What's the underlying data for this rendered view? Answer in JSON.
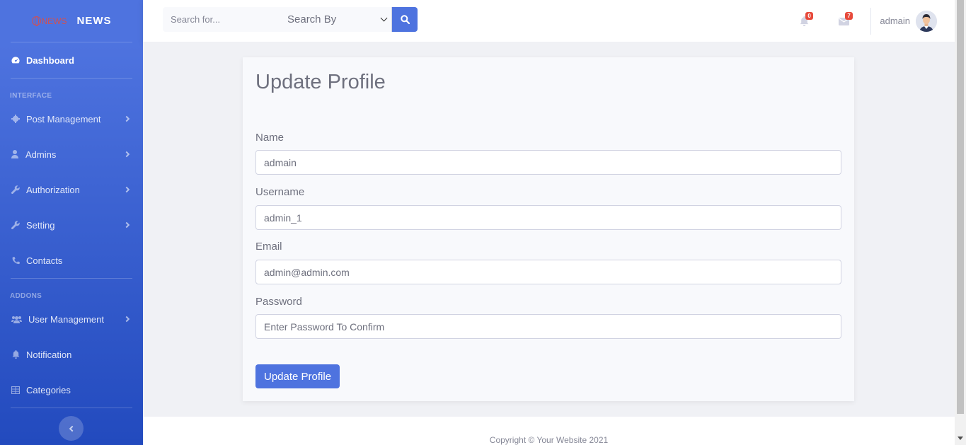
{
  "brand": {
    "logo_text": "NEWS",
    "title": "NEWS"
  },
  "sidebar": {
    "dashboard": "Dashboard",
    "heading_interface": "INTERFACE",
    "heading_addons": "ADDONS",
    "items": [
      {
        "label": "Post Management",
        "icon": "gear-icon"
      },
      {
        "label": "Admins",
        "icon": "user-icon"
      },
      {
        "label": "Authorization",
        "icon": "wrench-icon"
      },
      {
        "label": "Setting",
        "icon": "wrench-icon"
      },
      {
        "label": "Contacts",
        "icon": "phone-icon"
      },
      {
        "label": "User Management",
        "icon": "users-icon"
      },
      {
        "label": "Notification",
        "icon": "bell-icon"
      },
      {
        "label": "Categories",
        "icon": "table-icon"
      }
    ]
  },
  "topbar": {
    "search_placeholder": "Search for...",
    "search_by": "Search By",
    "alerts_count": "0",
    "messages_count": "7",
    "user_name": "admain"
  },
  "form": {
    "title": "Update Profile",
    "name_label": "Name",
    "name_value": "admain",
    "username_label": "Username",
    "username_value": "admin_1",
    "email_label": "Email",
    "email_value": "admin@admin.com",
    "password_label": "Password",
    "password_placeholder": "Enter Password To Confirm",
    "submit_label": "Update Profile"
  },
  "footer": {
    "copyright": "Copyright © Your Website 2021"
  },
  "colors": {
    "primary": "#4e73df",
    "danger": "#e74a3b"
  }
}
